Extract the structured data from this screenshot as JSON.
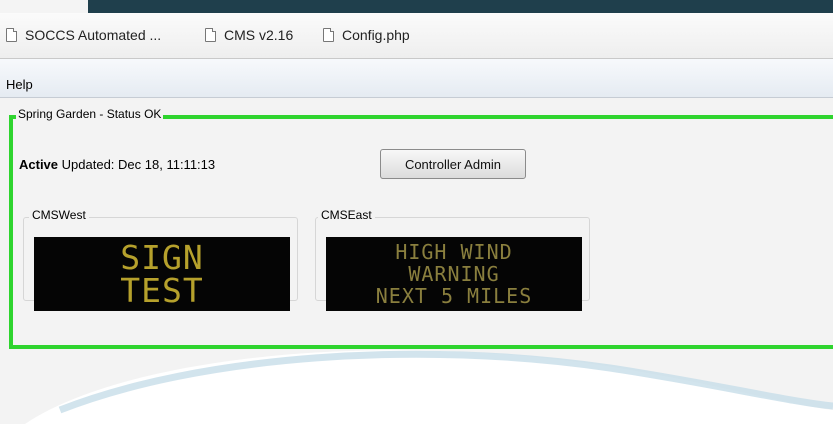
{
  "bookmarks": [
    {
      "label": "SOCCS Automated ..."
    },
    {
      "label": "CMS v2.16"
    },
    {
      "label": "Config.php"
    }
  ],
  "menu": {
    "help": "Help"
  },
  "status": {
    "title": "Spring Garden - Status OK",
    "active_label": "Active",
    "updated_text": "Updated: Dec 18, 11:11:13",
    "color": "#2ed42e"
  },
  "controller_admin_label": "Controller Admin",
  "signs": {
    "west": {
      "label": "CMSWest",
      "lines": [
        "SIGN",
        "TEST"
      ]
    },
    "east": {
      "label": "CMSEast",
      "lines": [
        "HIGH WIND",
        "WARNING",
        "NEXT 5 MILES"
      ]
    }
  },
  "colors": {
    "sign_text": "#b6a12c",
    "topbar": "#1f3f4c"
  }
}
